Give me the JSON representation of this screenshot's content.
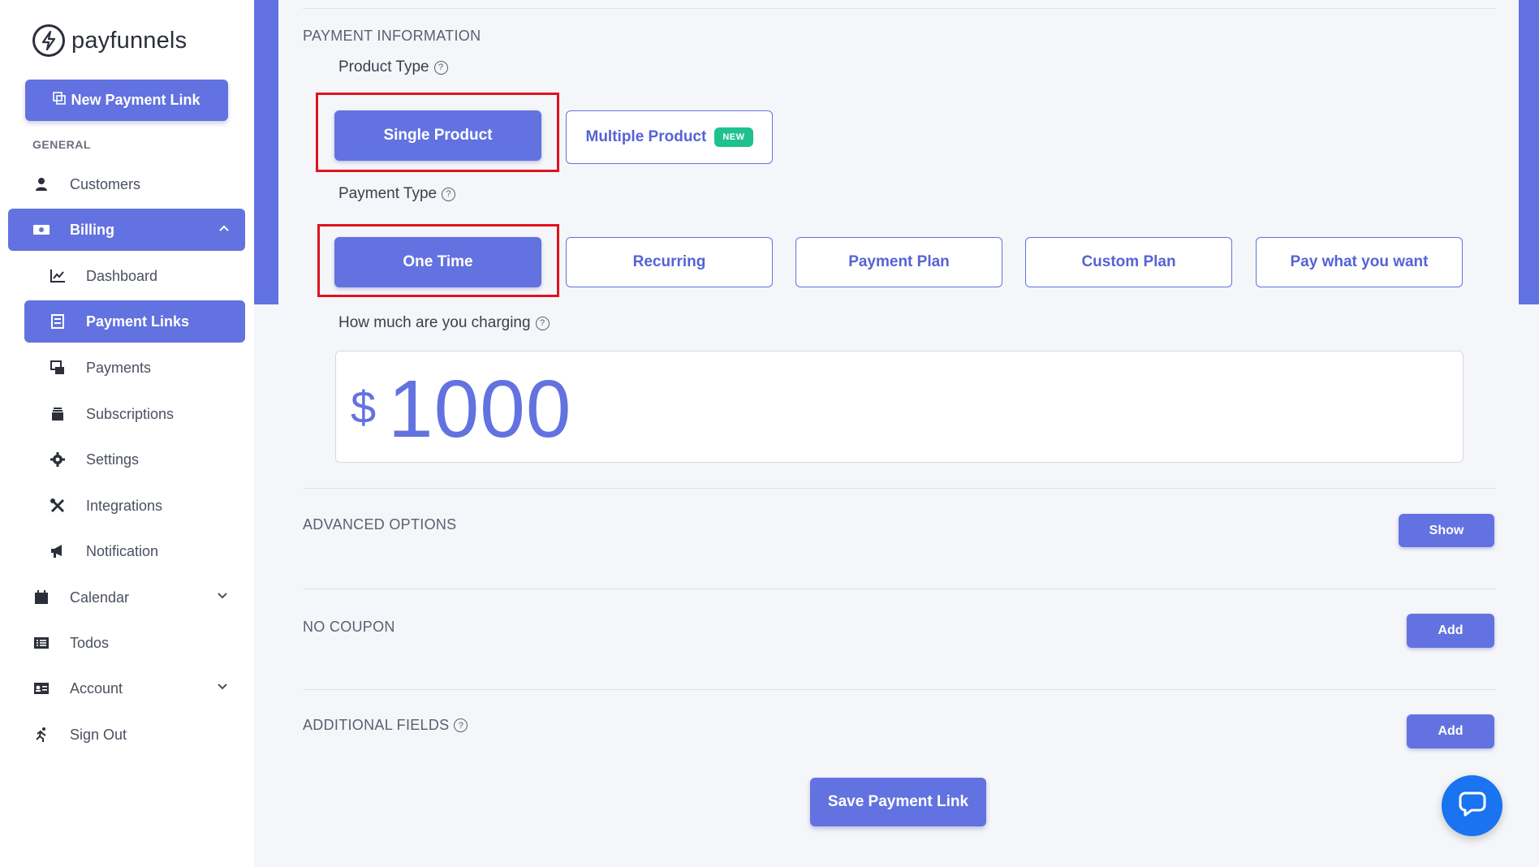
{
  "brand": {
    "name": "payfunnels",
    "accent": "#6272e0",
    "highlight": "#e0131f",
    "badge_color": "#1fc18f"
  },
  "sidebar": {
    "new_link_label": "New Payment Link",
    "section_general": "GENERAL",
    "items": [
      {
        "label": "Customers",
        "icon": "user-icon"
      },
      {
        "label": "Billing",
        "icon": "money-icon"
      },
      {
        "label": "Dashboard",
        "icon": "chart-icon"
      },
      {
        "label": "Payment Links",
        "icon": "link-list-icon"
      },
      {
        "label": "Payments",
        "icon": "payments-icon"
      },
      {
        "label": "Subscriptions",
        "icon": "subscriptions-icon"
      },
      {
        "label": "Settings",
        "icon": "gear-icon"
      },
      {
        "label": "Integrations",
        "icon": "tools-icon"
      },
      {
        "label": "Notification",
        "icon": "megaphone-icon"
      },
      {
        "label": "Calendar",
        "icon": "calendar-icon"
      },
      {
        "label": "Todos",
        "icon": "list-icon"
      },
      {
        "label": "Account",
        "icon": "id-card-icon"
      },
      {
        "label": "Sign Out",
        "icon": "running-icon"
      }
    ]
  },
  "main": {
    "payment_info_title": "PAYMENT INFORMATION",
    "product_type_label": "Product Type",
    "product_types": {
      "single": "Single Product",
      "multiple": "Multiple Product",
      "new_badge": "NEW"
    },
    "payment_type_label": "Payment Type",
    "payment_types": [
      "One Time",
      "Recurring",
      "Payment Plan",
      "Custom Plan",
      "Pay what you want"
    ],
    "charge_label": "How much are you charging",
    "currency_symbol": "$",
    "amount": "1000",
    "advanced_title": "ADVANCED OPTIONS",
    "advanced_button": "Show",
    "coupon_title": "NO COUPON",
    "coupon_button": "Add",
    "additional_title": "ADDITIONAL FIELDS",
    "additional_button": "Add",
    "save_button": "Save Payment Link"
  }
}
